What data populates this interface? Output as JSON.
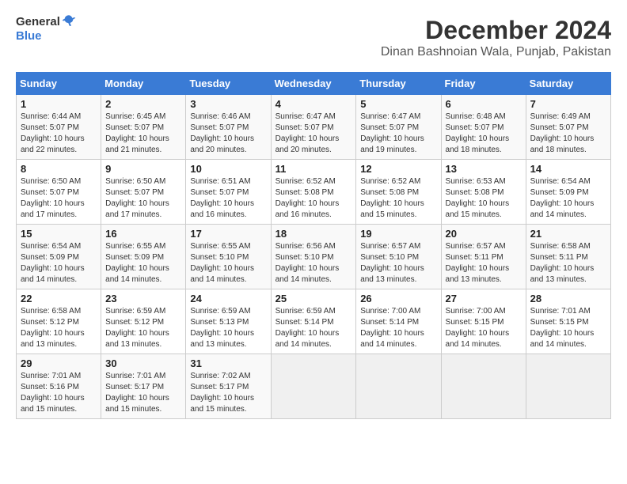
{
  "header": {
    "logo_general": "General",
    "logo_blue": "Blue",
    "month_title": "December 2024",
    "subtitle": "Dinan Bashnoian Wala, Punjab, Pakistan"
  },
  "days_of_week": [
    "Sunday",
    "Monday",
    "Tuesday",
    "Wednesday",
    "Thursday",
    "Friday",
    "Saturday"
  ],
  "weeks": [
    [
      {
        "day": "1",
        "sunrise": "6:44 AM",
        "sunset": "5:07 PM",
        "daylight": "10 hours and 22 minutes."
      },
      {
        "day": "2",
        "sunrise": "6:45 AM",
        "sunset": "5:07 PM",
        "daylight": "10 hours and 21 minutes."
      },
      {
        "day": "3",
        "sunrise": "6:46 AM",
        "sunset": "5:07 PM",
        "daylight": "10 hours and 20 minutes."
      },
      {
        "day": "4",
        "sunrise": "6:47 AM",
        "sunset": "5:07 PM",
        "daylight": "10 hours and 20 minutes."
      },
      {
        "day": "5",
        "sunrise": "6:47 AM",
        "sunset": "5:07 PM",
        "daylight": "10 hours and 19 minutes."
      },
      {
        "day": "6",
        "sunrise": "6:48 AM",
        "sunset": "5:07 PM",
        "daylight": "10 hours and 18 minutes."
      },
      {
        "day": "7",
        "sunrise": "6:49 AM",
        "sunset": "5:07 PM",
        "daylight": "10 hours and 18 minutes."
      }
    ],
    [
      {
        "day": "8",
        "sunrise": "6:50 AM",
        "sunset": "5:07 PM",
        "daylight": "10 hours and 17 minutes."
      },
      {
        "day": "9",
        "sunrise": "6:50 AM",
        "sunset": "5:07 PM",
        "daylight": "10 hours and 17 minutes."
      },
      {
        "day": "10",
        "sunrise": "6:51 AM",
        "sunset": "5:07 PM",
        "daylight": "10 hours and 16 minutes."
      },
      {
        "day": "11",
        "sunrise": "6:52 AM",
        "sunset": "5:08 PM",
        "daylight": "10 hours and 16 minutes."
      },
      {
        "day": "12",
        "sunrise": "6:52 AM",
        "sunset": "5:08 PM",
        "daylight": "10 hours and 15 minutes."
      },
      {
        "day": "13",
        "sunrise": "6:53 AM",
        "sunset": "5:08 PM",
        "daylight": "10 hours and 15 minutes."
      },
      {
        "day": "14",
        "sunrise": "6:54 AM",
        "sunset": "5:09 PM",
        "daylight": "10 hours and 14 minutes."
      }
    ],
    [
      {
        "day": "15",
        "sunrise": "6:54 AM",
        "sunset": "5:09 PM",
        "daylight": "10 hours and 14 minutes."
      },
      {
        "day": "16",
        "sunrise": "6:55 AM",
        "sunset": "5:09 PM",
        "daylight": "10 hours and 14 minutes."
      },
      {
        "day": "17",
        "sunrise": "6:55 AM",
        "sunset": "5:10 PM",
        "daylight": "10 hours and 14 minutes."
      },
      {
        "day": "18",
        "sunrise": "6:56 AM",
        "sunset": "5:10 PM",
        "daylight": "10 hours and 14 minutes."
      },
      {
        "day": "19",
        "sunrise": "6:57 AM",
        "sunset": "5:10 PM",
        "daylight": "10 hours and 13 minutes."
      },
      {
        "day": "20",
        "sunrise": "6:57 AM",
        "sunset": "5:11 PM",
        "daylight": "10 hours and 13 minutes."
      },
      {
        "day": "21",
        "sunrise": "6:58 AM",
        "sunset": "5:11 PM",
        "daylight": "10 hours and 13 minutes."
      }
    ],
    [
      {
        "day": "22",
        "sunrise": "6:58 AM",
        "sunset": "5:12 PM",
        "daylight": "10 hours and 13 minutes."
      },
      {
        "day": "23",
        "sunrise": "6:59 AM",
        "sunset": "5:12 PM",
        "daylight": "10 hours and 13 minutes."
      },
      {
        "day": "24",
        "sunrise": "6:59 AM",
        "sunset": "5:13 PM",
        "daylight": "10 hours and 13 minutes."
      },
      {
        "day": "25",
        "sunrise": "6:59 AM",
        "sunset": "5:14 PM",
        "daylight": "10 hours and 14 minutes."
      },
      {
        "day": "26",
        "sunrise": "7:00 AM",
        "sunset": "5:14 PM",
        "daylight": "10 hours and 14 minutes."
      },
      {
        "day": "27",
        "sunrise": "7:00 AM",
        "sunset": "5:15 PM",
        "daylight": "10 hours and 14 minutes."
      },
      {
        "day": "28",
        "sunrise": "7:01 AM",
        "sunset": "5:15 PM",
        "daylight": "10 hours and 14 minutes."
      }
    ],
    [
      {
        "day": "29",
        "sunrise": "7:01 AM",
        "sunset": "5:16 PM",
        "daylight": "10 hours and 15 minutes."
      },
      {
        "day": "30",
        "sunrise": "7:01 AM",
        "sunset": "5:17 PM",
        "daylight": "10 hours and 15 minutes."
      },
      {
        "day": "31",
        "sunrise": "7:02 AM",
        "sunset": "5:17 PM",
        "daylight": "10 hours and 15 minutes."
      },
      null,
      null,
      null,
      null
    ]
  ],
  "labels": {
    "sunrise": "Sunrise:",
    "sunset": "Sunset:",
    "daylight": "Daylight:"
  }
}
